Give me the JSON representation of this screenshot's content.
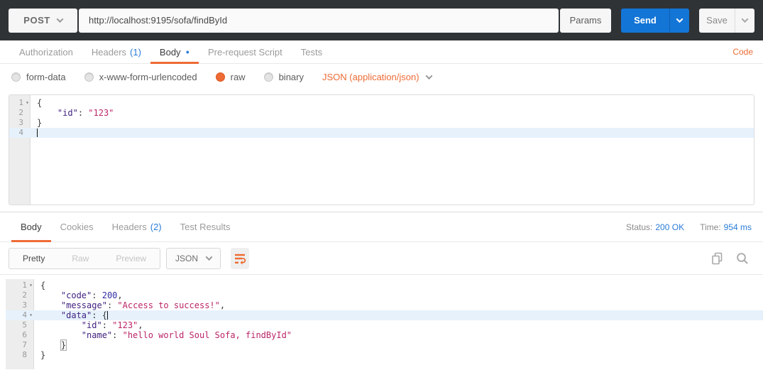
{
  "colors": {
    "accent_orange": "#ee6b35",
    "link_blue": "#2b7cd8",
    "send_blue": "#1375d6",
    "topbar_dark": "#303336",
    "token_key": "#40217f",
    "token_string": "#bb2468",
    "token_number": "#2e2ca3",
    "active_line": "#e6f1fc"
  },
  "icons": {
    "chevron_down": "chevron-down-icon",
    "fold_glyph": "▾",
    "body_dot_glyph": "●"
  },
  "topbar": {
    "method": "POST",
    "url": "http://localhost:9195/sofa/findById",
    "params": "Params",
    "send": "Send",
    "save": "Save"
  },
  "request_tabs": {
    "authorization": "Authorization",
    "headers": "Headers",
    "headers_count": "(1)",
    "body": "Body",
    "prerequest": "Pre-request Script",
    "tests": "Tests",
    "code_link": "Code"
  },
  "body_options": {
    "form_data": "form-data",
    "urlencoded": "x-www-form-urlencoded",
    "raw": "raw",
    "binary": "binary",
    "selected": "raw",
    "content_type": "JSON (application/json)"
  },
  "request_editor": {
    "lines": [
      {
        "num": "1",
        "fold": true,
        "active": false,
        "tokens": [
          {
            "t": "punct",
            "v": "{"
          }
        ]
      },
      {
        "num": "2",
        "fold": false,
        "active": false,
        "tokens": [
          {
            "t": "punct",
            "v": "    "
          },
          {
            "t": "key",
            "v": "\"id\""
          },
          {
            "t": "punct",
            "v": ": "
          },
          {
            "t": "str",
            "v": "\"123\""
          }
        ]
      },
      {
        "num": "3",
        "fold": false,
        "active": false,
        "tokens": [
          {
            "t": "punct",
            "v": "}"
          }
        ]
      },
      {
        "num": "4",
        "fold": false,
        "active": true,
        "tokens": [
          {
            "t": "cursor",
            "v": ""
          }
        ]
      }
    ]
  },
  "response_tabs": {
    "body": "Body",
    "cookies": "Cookies",
    "headers": "Headers",
    "headers_count": "(2)",
    "test_results": "Test Results",
    "status_label": "Status:",
    "status_value": "200 OK",
    "time_label": "Time:",
    "time_value": "954 ms"
  },
  "response_toolbar": {
    "pretty": "Pretty",
    "raw": "Raw",
    "preview": "Preview",
    "active_view": "Pretty",
    "format": "JSON"
  },
  "response_editor": {
    "lines": [
      {
        "num": "1",
        "fold": true,
        "active": false,
        "tokens": [
          {
            "t": "punct",
            "v": "{"
          }
        ]
      },
      {
        "num": "2",
        "fold": false,
        "active": false,
        "tokens": [
          {
            "t": "punct",
            "v": "    "
          },
          {
            "t": "key",
            "v": "\"code\""
          },
          {
            "t": "punct",
            "v": ": "
          },
          {
            "t": "num",
            "v": "200"
          },
          {
            "t": "punct",
            "v": ","
          }
        ]
      },
      {
        "num": "3",
        "fold": false,
        "active": false,
        "tokens": [
          {
            "t": "punct",
            "v": "    "
          },
          {
            "t": "key",
            "v": "\"message\""
          },
          {
            "t": "punct",
            "v": ": "
          },
          {
            "t": "str",
            "v": "\"Access to success!\""
          },
          {
            "t": "punct",
            "v": ","
          }
        ]
      },
      {
        "num": "4",
        "fold": true,
        "active": true,
        "tokens": [
          {
            "t": "punct",
            "v": "    "
          },
          {
            "t": "key",
            "v": "\"data\""
          },
          {
            "t": "punct",
            "v": ": "
          },
          {
            "t": "punct",
            "v": "{"
          },
          {
            "t": "cursor",
            "v": ""
          }
        ]
      },
      {
        "num": "5",
        "fold": false,
        "active": false,
        "tokens": [
          {
            "t": "punct",
            "v": "        "
          },
          {
            "t": "key",
            "v": "\"id\""
          },
          {
            "t": "punct",
            "v": ": "
          },
          {
            "t": "str",
            "v": "\"123\""
          },
          {
            "t": "punct",
            "v": ","
          }
        ]
      },
      {
        "num": "6",
        "fold": false,
        "active": false,
        "tokens": [
          {
            "t": "punct",
            "v": "        "
          },
          {
            "t": "key",
            "v": "\"name\""
          },
          {
            "t": "punct",
            "v": ": "
          },
          {
            "t": "str",
            "v": "\"hello world Soul Sofa, findById\""
          }
        ]
      },
      {
        "num": "7",
        "fold": false,
        "active": false,
        "tokens": [
          {
            "t": "punct",
            "v": "    "
          },
          {
            "t": "punct",
            "v": "}",
            "match": true
          }
        ]
      },
      {
        "num": "8",
        "fold": false,
        "active": false,
        "tokens": [
          {
            "t": "punct",
            "v": "}"
          }
        ]
      }
    ]
  }
}
